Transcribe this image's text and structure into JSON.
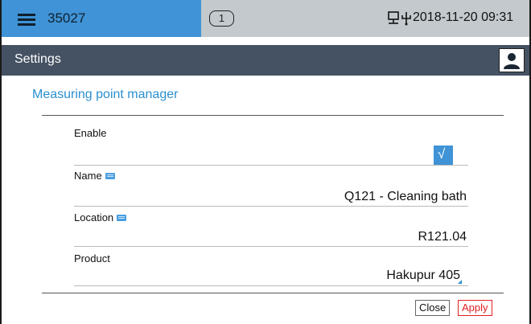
{
  "status_bar": {
    "device_id": "35027",
    "message_count": "1",
    "datetime": "2018-11-20 09:31",
    "icons": [
      "network-icon",
      "usb-icon"
    ]
  },
  "header": {
    "title": "Settings",
    "user_icon": "user-icon"
  },
  "section": {
    "title": "Measuring point manager"
  },
  "fields": {
    "enable": {
      "label": "Enable",
      "checked": true,
      "check_glyph": "√"
    },
    "name": {
      "label": "Name",
      "value": "Q121 - Cleaning bath"
    },
    "location": {
      "label": "Location",
      "value": "R121.04"
    },
    "product": {
      "label": "Product",
      "value": "Hakupur 405"
    }
  },
  "buttons": {
    "close": "Close",
    "apply": "Apply"
  },
  "colors": {
    "accent_blue": "#3f93d6",
    "header_bg": "#455263",
    "status_bg": "#c3c9cc",
    "title_blue": "#2b8fcf",
    "apply_red": "#e02020"
  }
}
